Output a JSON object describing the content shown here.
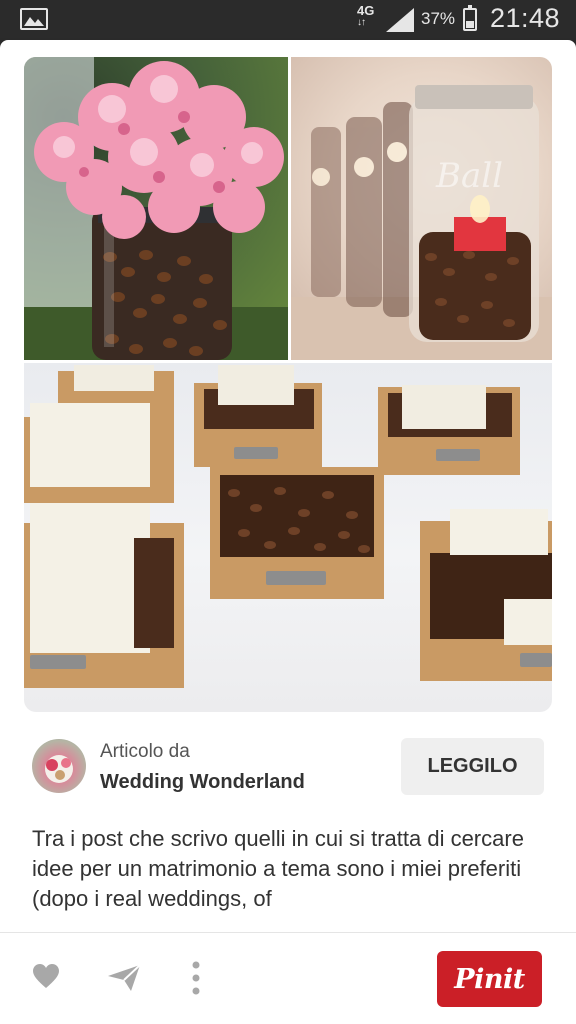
{
  "status_bar": {
    "network": "4G",
    "battery_percent": "37%",
    "battery_level": 0.37,
    "time": "21:48"
  },
  "pin": {
    "source_label": "Articolo da",
    "source_name": "Wedding Wonderland",
    "read_label": "LEGGILO",
    "description": "Tra i post che scrivo quelli in cui si tratta di cercare idee per un matrimonio a tema sono i miei preferiti (dopo i real weddings, of"
  },
  "actions": {
    "pin_label": "Pinit",
    "icons": [
      "heart-icon",
      "send-icon",
      "more-icon"
    ]
  },
  "colors": {
    "brand_red": "#cb1f27",
    "status_bar_bg": "#2b2b2b"
  }
}
